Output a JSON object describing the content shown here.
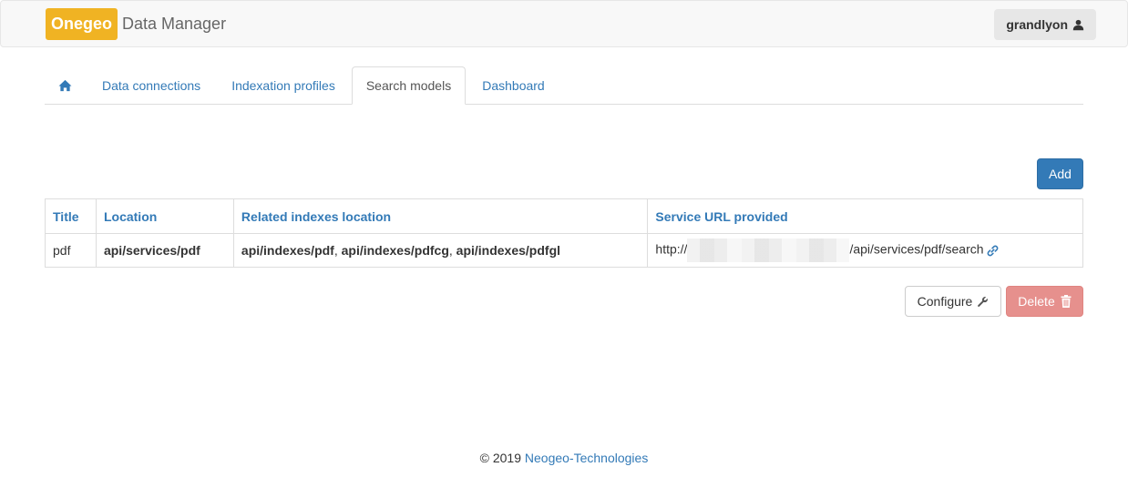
{
  "navbar": {
    "brand_badge": "Onegeo",
    "brand_text": "Data Manager",
    "user": "grandlyon"
  },
  "tabs": [
    {
      "label": "",
      "icon": "home-icon"
    },
    {
      "label": "Data connections"
    },
    {
      "label": "Indexation profiles"
    },
    {
      "label": "Search models",
      "active": true
    },
    {
      "label": "Dashboard"
    }
  ],
  "actions": {
    "add_label": "Add",
    "configure_label": "Configure",
    "delete_label": "Delete"
  },
  "table": {
    "headers": [
      "Title",
      "Location",
      "Related indexes location",
      "Service URL provided"
    ],
    "rows": [
      {
        "title": "pdf",
        "location": "api/services/pdf",
        "related": [
          "api/indexes/pdf",
          "api/indexes/pdfcg",
          "api/indexes/pdfgl"
        ],
        "related_sep": ", ",
        "url_prefix": "http://",
        "url_suffix": "/api/services/pdf/search"
      }
    ]
  },
  "footer": {
    "copyright": "© 2019",
    "company": "Neogeo-Technologies"
  },
  "colors": {
    "brand": "#f0b323",
    "link": "#337ab7",
    "primary": "#337ab7",
    "danger_disabled": "#e6908d"
  }
}
